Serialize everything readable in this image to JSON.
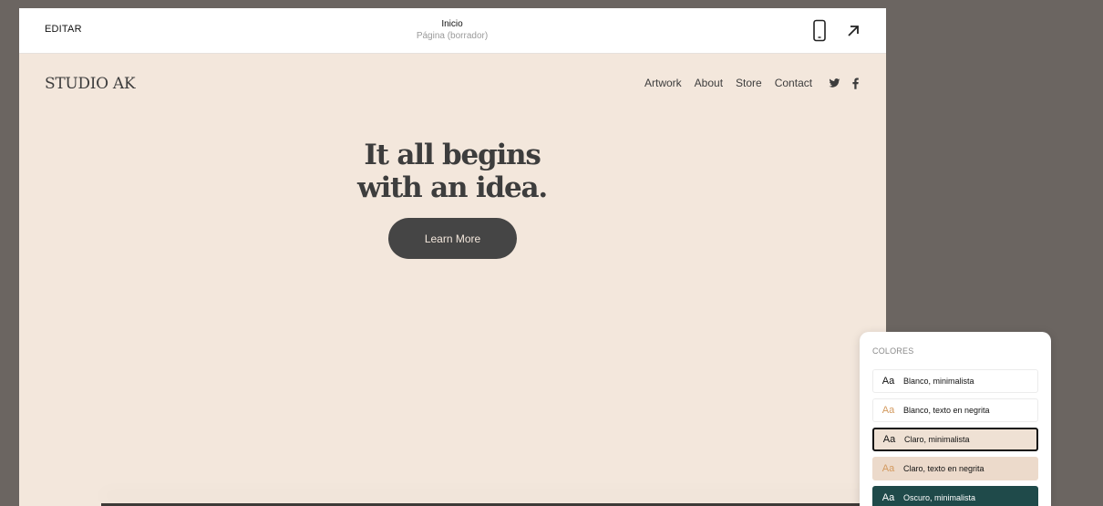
{
  "topbar": {
    "edit_label": "EDITAR",
    "page_title": "Inicio",
    "page_status": "Página (borrador)",
    "icons": [
      "mobile-icon",
      "open-external-icon"
    ]
  },
  "site": {
    "logo": "STUDIO AK",
    "nav": [
      "Artwork",
      "About",
      "Store",
      "Contact"
    ],
    "social_icons": [
      "twitter-icon",
      "facebook-icon"
    ],
    "headline_line1": "It all begins",
    "headline_line2": "with an idea.",
    "cta_label": "Learn More",
    "background_color": "#f3e7dc",
    "text_color": "#3d3d3d"
  },
  "colors_panel": {
    "title": "COLORES",
    "selected": "Claro, minimalista",
    "options": [
      {
        "label": "Blanco, minimalista",
        "aa": "Aa",
        "bg": "#ffffff",
        "aa_color": "#111111",
        "text_color": "#111111"
      },
      {
        "label": "Blanco, texto en negrita",
        "aa": "Aa",
        "bg": "#ffffff",
        "aa_color": "#d39a5f",
        "text_color": "#111111"
      },
      {
        "label": "Claro, minimalista",
        "aa": "Aa",
        "bg": "#efe1d4",
        "aa_color": "#111111",
        "text_color": "#111111"
      },
      {
        "label": "Claro, texto en negrita",
        "aa": "Aa",
        "bg": "#ecdacb",
        "aa_color": "#d39a5f",
        "text_color": "#111111"
      },
      {
        "label": "Oscuro, minimalista",
        "aa": "Aa",
        "bg": "#1f4a4a",
        "aa_color": "#ffffff",
        "text_color": "#ffffff"
      }
    ]
  }
}
